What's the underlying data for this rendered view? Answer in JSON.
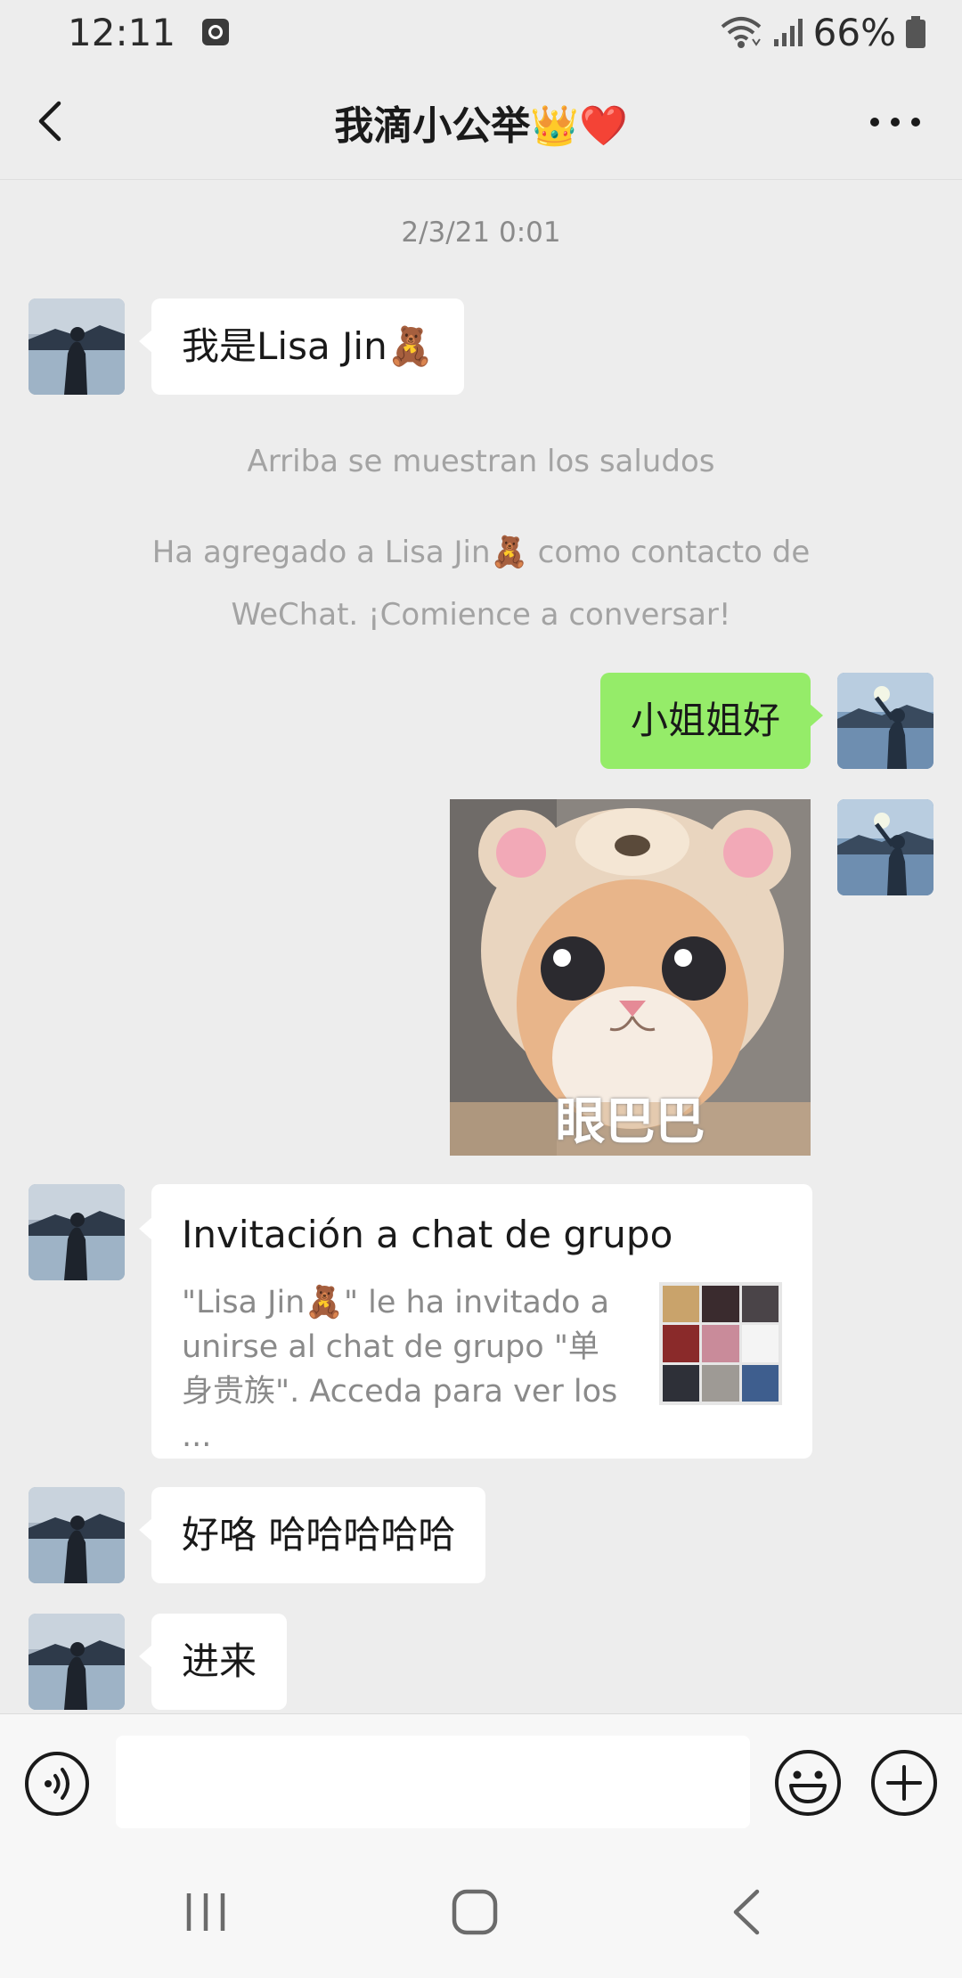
{
  "status_bar": {
    "time": "12:11",
    "battery": "66%"
  },
  "header": {
    "title": "我滴小公举👑❤️"
  },
  "chat": {
    "timestamp": "2/3/21 0:01",
    "messages": {
      "m1": "我是Lisa Jin🧸",
      "sys1": "Arriba se muestran los saludos",
      "sys2": "Ha agregado a Lisa Jin🧸 como contacto de WeChat. ¡Comience a conversar!",
      "m2": "小姐姐好",
      "sticker_caption": "眼巴巴",
      "m4": "好咯 哈哈哈哈哈",
      "m5": "进来"
    },
    "group_invite": {
      "title": "Invitación a chat de grupo",
      "description": "\"Lisa Jin🧸\" le ha invitado a unirse al chat de grupo \"单身贵族\". Acceda para ver los ..."
    }
  },
  "input": {
    "value": "",
    "placeholder": ""
  },
  "icons": {
    "back": "chevron-left-icon",
    "more": "more-dots-icon",
    "voice": "voice-icon",
    "emoji": "emoji-icon",
    "plus": "plus-icon"
  },
  "colors": {
    "background": "#ededed",
    "outgoing_bubble": "#95ec69",
    "incoming_bubble": "#ffffff"
  }
}
